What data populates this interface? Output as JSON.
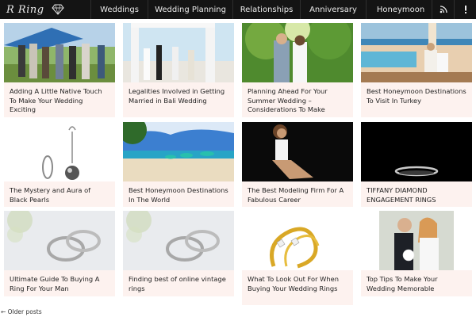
{
  "header": {
    "logo_text": "R Ring",
    "nav": [
      "Weddings",
      "Wedding Planning",
      "Relationships",
      "Anniversary",
      "Honeymoon"
    ],
    "icons": [
      "rss-icon",
      "alert-icon"
    ]
  },
  "posts": [
    {
      "title": "Adding A Little Native Touch To Make Your Wedding Exciting"
    },
    {
      "title": "Legalities Involved in Getting Married in Bali Wedding"
    },
    {
      "title": "Planning Ahead For Your Summer Wedding – Considerations To Make"
    },
    {
      "title": "Best Honeymoon Destinations To Visit In Turkey"
    },
    {
      "title": "The Mystery and Aura of Black Pearls"
    },
    {
      "title": "Best Honeymoon Destinations In The World"
    },
    {
      "title": "The Best Modeling Firm For A Fabulous Career"
    },
    {
      "title": "TIFFANY DIAMOND ENGAGEMENT RINGS"
    },
    {
      "title": "Ultimate Guide To Buying A Ring For Your Man"
    },
    {
      "title": "Finding best of online vintage rings"
    },
    {
      "title": "What To Look Out For When Buying Your Wedding Rings"
    },
    {
      "title": "Top Tips To Make Your Wedding Memorable"
    }
  ],
  "pagination": {
    "older": "← Older posts"
  },
  "colors": {
    "header_bg": "#141414",
    "caption_bg": "#fdf2ef"
  }
}
